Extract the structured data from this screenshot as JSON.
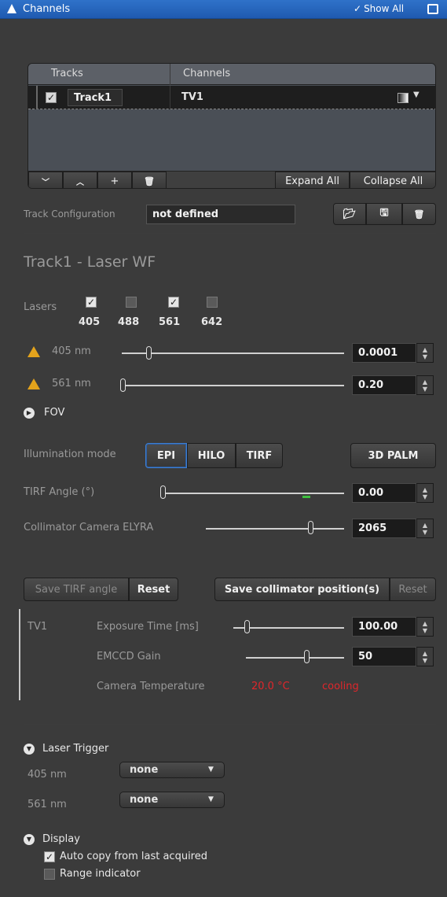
{
  "titlebar": {
    "title": "Channels",
    "show_all_label": "Show All",
    "icons": [
      "triangle-logo-icon",
      "check-icon",
      "detach-window-icon"
    ]
  },
  "tracks_table": {
    "headers": [
      "Tracks",
      "Channels"
    ],
    "rows": [
      {
        "checked": true,
        "track": "Track1",
        "channel": "TV1"
      }
    ],
    "toolbar": {
      "expand_all": "Expand All",
      "collapse_all": "Collapse All",
      "icons": [
        "chevron-down-icon",
        "chevron-up-icon",
        "plus-icon",
        "trash-icon"
      ]
    }
  },
  "track_configuration": {
    "label": "Track Configuration",
    "value": "not defined",
    "icons": [
      "folder-open-icon",
      "save-icon",
      "trash-icon"
    ]
  },
  "track_title": "Track1 - Laser WF",
  "lasers": {
    "label": "Lasers",
    "items": [
      {
        "wavelength": "405",
        "checked": true
      },
      {
        "wavelength": "488",
        "checked": false
      },
      {
        "wavelength": "561",
        "checked": true
      },
      {
        "wavelength": "642",
        "checked": false
      }
    ],
    "power": [
      {
        "label": "405 nm",
        "value": "0.0001",
        "level": 0.1
      },
      {
        "label": "561 nm",
        "value": "0.20",
        "level": 0.0
      }
    ]
  },
  "fov": {
    "label": "FOV"
  },
  "illumination": {
    "label": "Illumination mode",
    "modes": [
      "EPI",
      "HILO",
      "TIRF"
    ],
    "selected": "EPI",
    "palm_label": "3D PALM"
  },
  "tirf_angle": {
    "label": "TIRF Angle (°)",
    "value": "0.00",
    "level": 0.0
  },
  "collimator": {
    "label": "Collimator Camera ELYRA",
    "value": "2065",
    "level": 0.75
  },
  "buttons": {
    "save_tirf": "Save TIRF angle",
    "reset1": "Reset",
    "save_collimator": "Save collimator position(s)",
    "reset2": "Reset"
  },
  "camera": {
    "channel": "TV1",
    "exposure_label": "Exposure Time [ms]",
    "exposure_value": "100.00",
    "exposure_level": 0.1,
    "gain_label": "EMCCD Gain",
    "gain_value": "50",
    "gain_level": 0.65,
    "temp_label": "Camera Temperature",
    "temp_value": "20.0 °C",
    "temp_status": "cooling",
    "temp_color": "#e0262b"
  },
  "laser_trigger": {
    "label": "Laser Trigger",
    "rows": [
      {
        "label": "405 nm",
        "value": "none"
      },
      {
        "label": "561 nm",
        "value": "none"
      }
    ]
  },
  "display": {
    "label": "Display",
    "options": [
      {
        "label": "Auto copy from last acquired",
        "checked": true
      },
      {
        "label": "Range indicator",
        "checked": false
      }
    ]
  },
  "colors": {
    "accent": "#2f72c9",
    "warning": "#e3a31c",
    "temp_red": "#e0262b",
    "indicator_green": "#3fbf3f"
  }
}
